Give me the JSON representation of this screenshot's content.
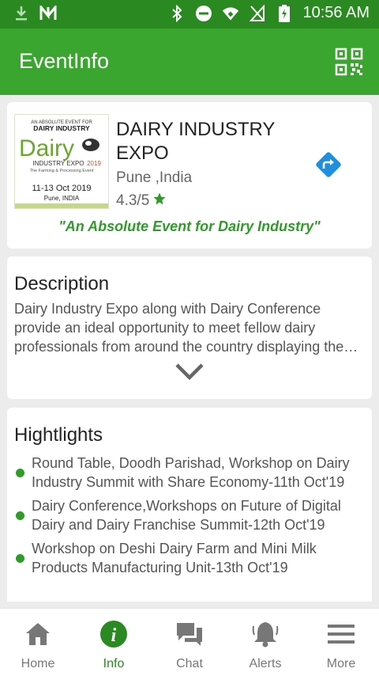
{
  "status_bar": {
    "time": "10:56 AM"
  },
  "app_bar": {
    "title": "EventInfo"
  },
  "event": {
    "name": "DAIRY INDUSTRY EXPO",
    "location": "Pune ,India",
    "rating": "4.3/5",
    "tagline": "\"An Absolute Event for Dairy Industry\"",
    "logo": {
      "line1": "AN ABSOLUTE EVENT FOR",
      "line2": "DAIRY INDUSTRY",
      "line3": "Dairy",
      "line4": "INDUSTRY EXPO",
      "line4b": "2019",
      "line5": "The Farming & Processing Event",
      "line6": "11-13 Oct 2019",
      "line7": "Pune, INDIA"
    }
  },
  "description": {
    "title": "Description",
    "text": "Dairy Industry Expo along with Dairy Conference provide an ideal opportunity to meet fellow dairy professionals from around the country displaying the latest products and services in the industry."
  },
  "highlights": {
    "title": "Hightlights",
    "items": [
      "Round Table, Doodh Parishad, Workshop on Dairy Industry Summit with Share Economy-11th Oct'19",
      "Dairy Conference,Workshops on Future of Digital Dairy and Dairy Franchise Summit-12th Oct'19",
      "Workshop on Deshi Dairy Farm and Mini Milk Products Manufacturing Unit-13th Oct'19"
    ]
  },
  "nav": {
    "items": [
      {
        "label": "Home",
        "icon": "home-icon"
      },
      {
        "label": "Info",
        "icon": "info-icon"
      },
      {
        "label": "Chat",
        "icon": "chat-icon"
      },
      {
        "label": "Alerts",
        "icon": "bell-icon"
      },
      {
        "label": "More",
        "icon": "menu-icon"
      }
    ],
    "active": "Info"
  },
  "colors": {
    "primary": "#3aa62f",
    "primary_dark": "#2a8a21",
    "accent_blue": "#1e90e0"
  }
}
